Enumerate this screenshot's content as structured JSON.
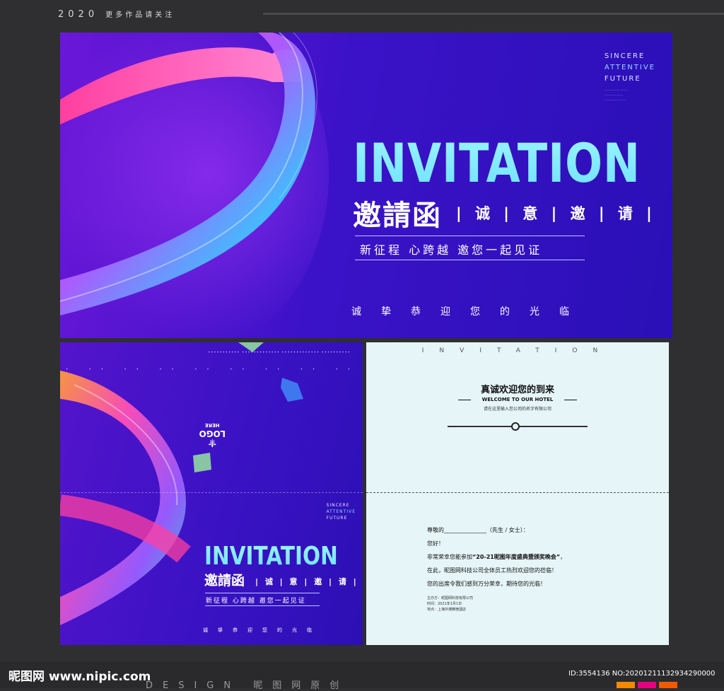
{
  "header": {
    "year": "2020",
    "follow_text": "更多作品请关注"
  },
  "banner": {
    "brand_lines": [
      "SINCERE",
      "ATTENTIVE",
      "FUTURE"
    ],
    "title_en": "INVITATION",
    "title_cn": "邀請函",
    "subtitle_cn": "| 诚 | 意 | 邀 | 请 |",
    "slogan": "新征程 心跨越 邀您一起见证",
    "welcome": "诚挚恭迎您的光临"
  },
  "card_front": {
    "logo": "LOGO",
    "logo_sub": "HERE",
    "brand_lines": [
      "SINCERE",
      "ATTENTIVE",
      "FUTURE"
    ],
    "title_en": "INVITATION",
    "title_cn": "邀請函",
    "subtitle_cn": "| 诚 | 意 | 邀 | 请 |",
    "slogan": "新征程 心跨越 邀您一起见证",
    "welcome": "诚挚恭迎您的光临"
  },
  "card_inside": {
    "header": "INVITATION",
    "greeting_cn": "真诚欢迎您的到来",
    "greeting_en": "WELCOME TO OUR HOTEL",
    "note": "请在这里输入您公司的名字有限公司",
    "letter": {
      "salutation": "尊敬的_______________（先生 / 女士）：",
      "hello": "您好！",
      "line1_prefix": "非常荣幸您能参加",
      "event": "“20-21昵图年度盛典暨颁奖晚会”",
      "line1_suffix": "，",
      "line2": "在此，昵图网科技公司全体员工热烈欢迎您的莅临！",
      "line3": "您的出席令我们感到万分荣幸，期待您的光临！"
    },
    "footer": [
      "主办方：昵图网科技有限公司",
      "时间：2021年1月1日",
      "地点：上海外滩精宿酒店"
    ]
  },
  "footer": {
    "site": "昵图网 www.nipic.com",
    "design": "DESIGN 昵图网原创",
    "id_text": "ID:3554136 NO:20201211132934290000"
  },
  "colors": {
    "background": "#2f2f31",
    "panel_purple": "#3b12c8",
    "title_cyan": "#7ae8ff",
    "card_paper": "#e6f5f7",
    "swatches": [
      "#f28a00",
      "#e5007e",
      "#f05a00"
    ]
  }
}
